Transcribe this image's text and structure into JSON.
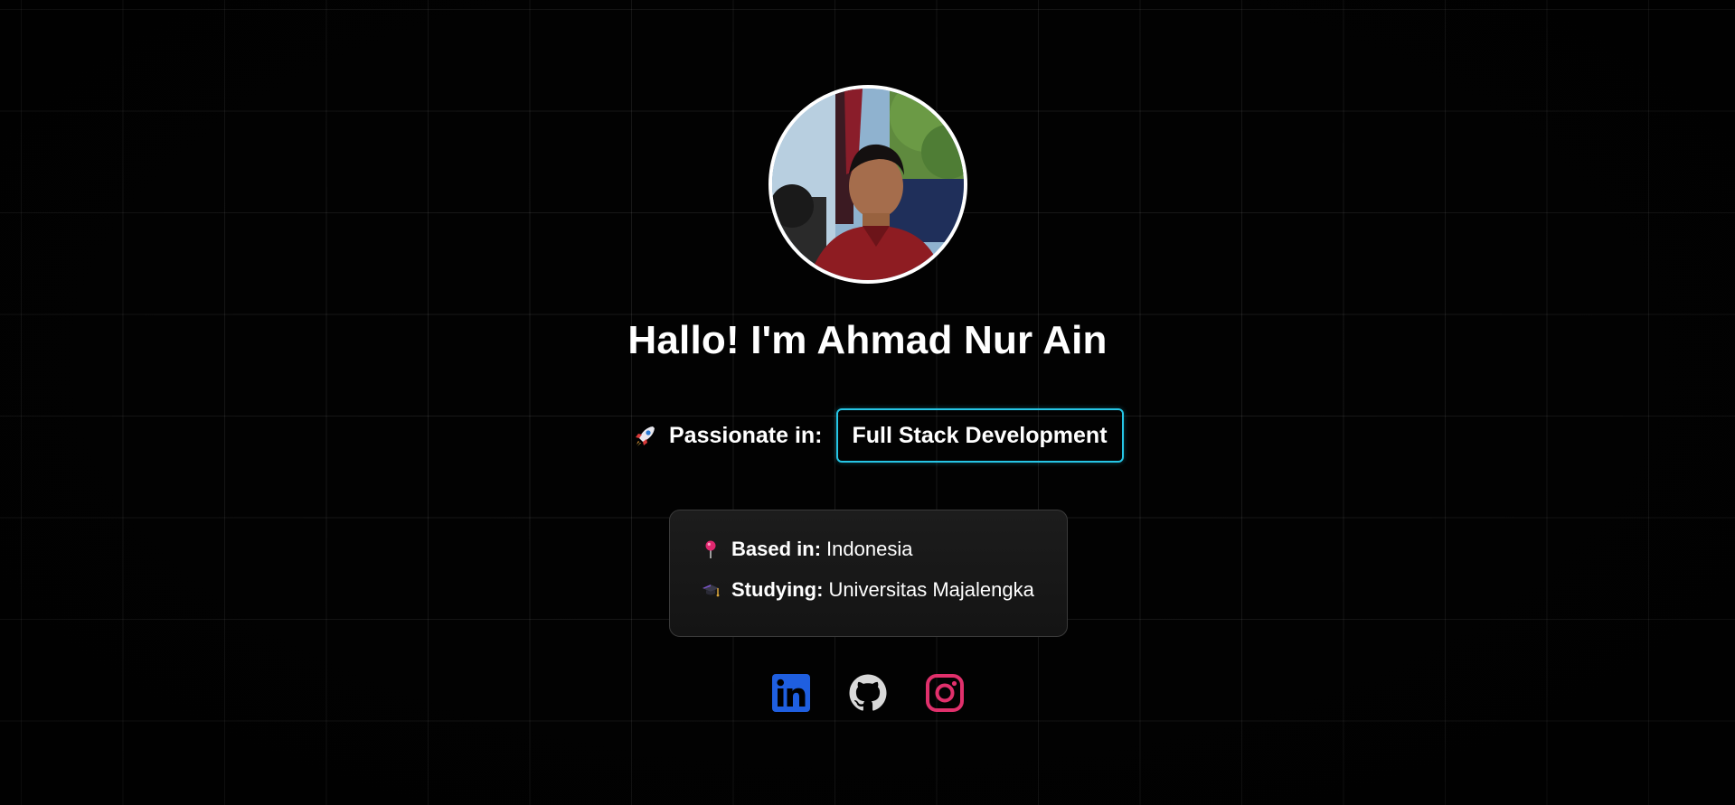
{
  "profile": {
    "heading": "Hallo! I'm Ahmad Nur Ain",
    "passion_label": "Passionate in:",
    "passion_value": "Full Stack Development"
  },
  "info": {
    "items": [
      {
        "icon": "pin-icon",
        "label": "Based in:",
        "value": "Indonesia"
      },
      {
        "icon": "graduation-cap-icon",
        "label": "Studying:",
        "value": "Universitas Majalengka"
      }
    ]
  },
  "social": {
    "links": [
      {
        "name": "linkedin",
        "icon": "linkedin-icon",
        "color": "#0a66c2"
      },
      {
        "name": "github",
        "icon": "github-icon",
        "color": "#d9d9d9"
      },
      {
        "name": "instagram",
        "icon": "instagram-icon",
        "color": "#e1306c"
      }
    ]
  },
  "colors": {
    "background": "#020202",
    "accent_border": "#26c6e6",
    "card_background": "#1a1a1a",
    "text": "#ffffff"
  }
}
